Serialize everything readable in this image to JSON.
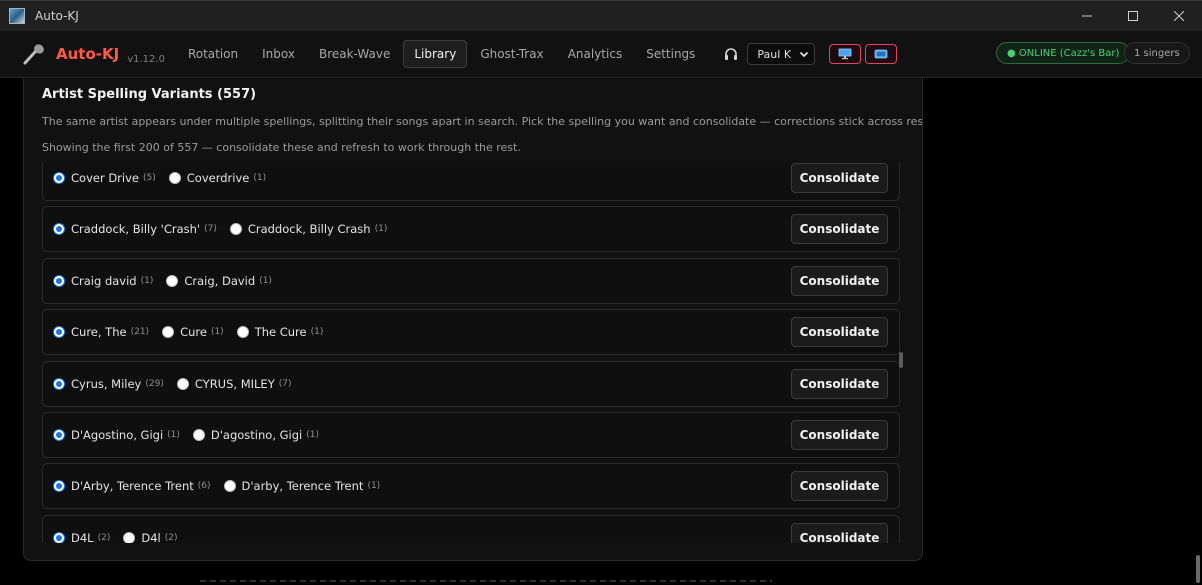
{
  "window": {
    "title": "Auto-KJ"
  },
  "header": {
    "brand": "Auto-KJ",
    "version": "v1.12.0",
    "nav": [
      "Rotation",
      "Inbox",
      "Break-Wave",
      "Library",
      "Ghost-Trax",
      "Analytics",
      "Settings"
    ],
    "active_nav": "Library",
    "user": "Paul K",
    "status": "● ONLINE (Cazz's Bar)",
    "singers": "1 singers",
    "colors": {
      "brand": "#ff5a47",
      "online": "#4ccf73",
      "accent_border": "#e0475d"
    }
  },
  "panel": {
    "title": "Artist Spelling Variants (557)",
    "description": "The same artist appears under multiple spellings, splitting their songs apart in search. Pick the spelling you want and consolidate — corrections stick across rescans.",
    "showing": "Showing the first 200 of 557 — consolidate these and refresh to work through the rest.",
    "button_label": "Consolidate",
    "rows": [
      {
        "options": [
          {
            "name": "Cover Drive",
            "count": "(5)",
            "selected": true
          },
          {
            "name": "Coverdrive",
            "count": "(1)",
            "selected": false
          }
        ]
      },
      {
        "options": [
          {
            "name": "Craddock, Billy 'Crash'",
            "count": "(7)",
            "selected": true
          },
          {
            "name": "Craddock, Billy Crash",
            "count": "(1)",
            "selected": false
          }
        ]
      },
      {
        "options": [
          {
            "name": "Craig david",
            "count": "(1)",
            "selected": true
          },
          {
            "name": "Craig, David",
            "count": "(1)",
            "selected": false
          }
        ]
      },
      {
        "options": [
          {
            "name": "Cure, The",
            "count": "(21)",
            "selected": true
          },
          {
            "name": "Cure",
            "count": "(1)",
            "selected": false
          },
          {
            "name": "The Cure",
            "count": "(1)",
            "selected": false
          }
        ]
      },
      {
        "options": [
          {
            "name": "Cyrus, Miley",
            "count": "(29)",
            "selected": true
          },
          {
            "name": "CYRUS, MILEY",
            "count": "(7)",
            "selected": false
          }
        ]
      },
      {
        "options": [
          {
            "name": "D'Agostino, Gigi",
            "count": "(1)",
            "selected": true
          },
          {
            "name": "D'agostino, Gigi",
            "count": "(1)",
            "selected": false
          }
        ]
      },
      {
        "options": [
          {
            "name": "D'Arby, Terence Trent",
            "count": "(6)",
            "selected": true
          },
          {
            "name": "D'arby, Terence Trent",
            "count": "(1)",
            "selected": false
          }
        ]
      },
      {
        "options": [
          {
            "name": "D4L",
            "count": "(2)",
            "selected": true
          },
          {
            "name": "D4l",
            "count": "(2)",
            "selected": false
          }
        ]
      }
    ]
  }
}
